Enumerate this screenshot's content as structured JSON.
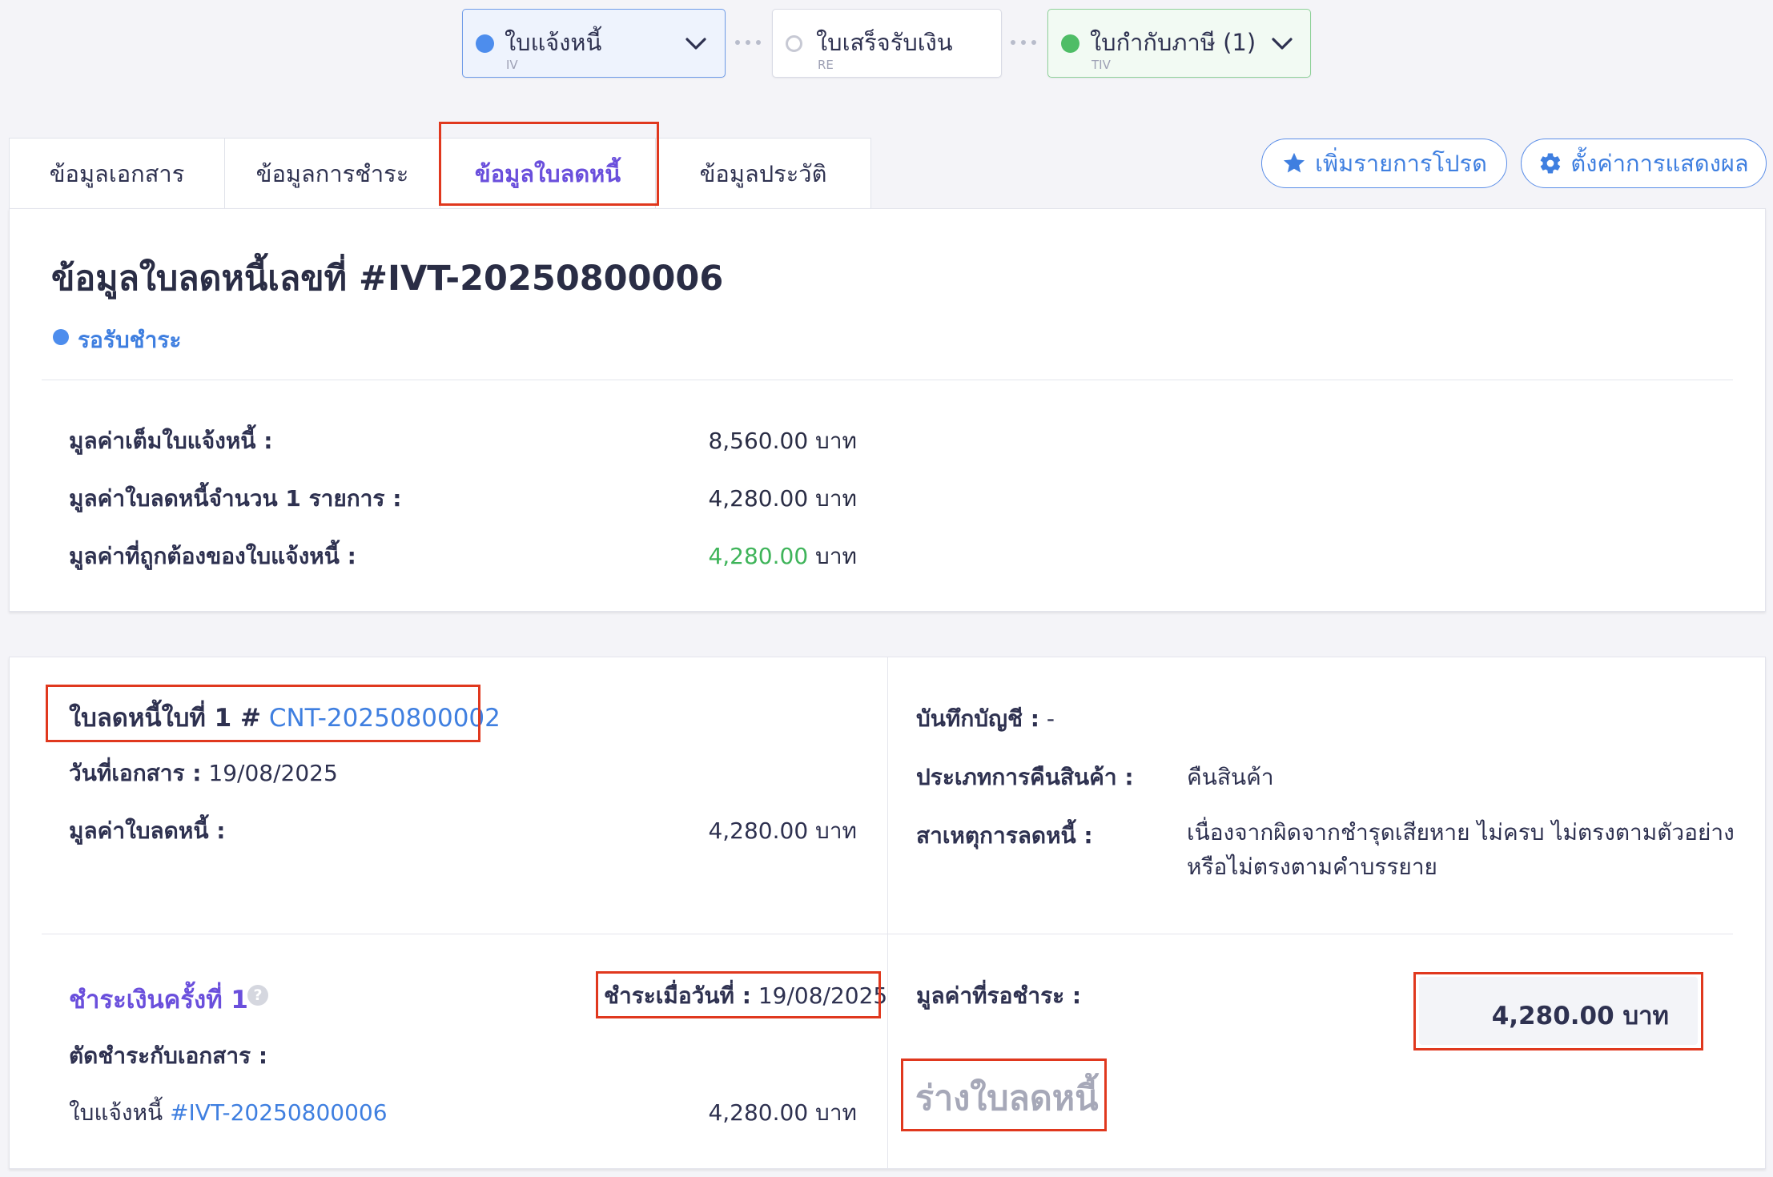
{
  "flow": {
    "steps": [
      {
        "label": "ใบแจ้งหนี้",
        "code": "IV"
      },
      {
        "label": "ใบเสร็จรับเงิน",
        "code": "RE"
      },
      {
        "label": "ใบกำกับภาษี (1)",
        "code": "TIV"
      }
    ]
  },
  "tabs": [
    "ข้อมูลเอกสาร",
    "ข้อมูลการชำระ",
    "ข้อมูลใบลดหนี้",
    "ข้อมูลประวัติ"
  ],
  "actions": {
    "favorite": "เพิ่มรายการโปรด",
    "display_settings": "ตั้งค่าการแสดงผล"
  },
  "summary": {
    "title": "ข้อมูลใบลดหนี้เลขที่ #IVT-20250800006",
    "status": "รอรับชำระ",
    "rows": [
      {
        "label": "มูลค่าเต็มใบแจ้งหนี้ :",
        "value": "8,560.00",
        "unit": "บาท"
      },
      {
        "label": "มูลค่าใบลดหนี้จำนวน 1 รายการ :",
        "value": "4,280.00",
        "unit": "บาท"
      },
      {
        "label": "มูลค่าที่ถูกต้องของใบแจ้งหนี้ :",
        "value": "4,280.00",
        "unit": "บาท"
      }
    ]
  },
  "credit_note": {
    "heading_prefix": "ใบลดหนี้ใบที่ 1 #",
    "number": "CNT-20250800002",
    "doc_date_label": "วันที่เอกสาร :",
    "doc_date": "19/08/2025",
    "value_label": "มูลค่าใบลดหนี้ :",
    "value": "4,280.00 บาท",
    "account_label": "บันทึกบัญชี :",
    "account_value": "-",
    "return_type_label": "ประเภทการคืนสินค้า :",
    "return_type": "คืนสินค้า",
    "reason_label": "สาเหตุการลดหนี้ :",
    "reason_line1": "เนื่องจากผิดจากชำรุดเสียหาย ไม่ครบ ไม่ตรงตามตัวอย่าง",
    "reason_line2": "หรือไม่ตรงตามคำบรรยาย"
  },
  "payment": {
    "title": "ชำระเงินครั้งที่ 1",
    "paid_on_label": "ชำระเมื่อวันที่ :",
    "paid_on": "19/08/2025",
    "offset_label": "ตัดชำระกับเอกสาร :",
    "doc_prefix": "ใบแจ้งหนี้",
    "doc_number": "#IVT-20250800006",
    "doc_amount": "4,280.00 บาท",
    "pending_label": "มูลค่าที่รอชำระ :",
    "pending_value": "4,280.00 บาท",
    "draft_label": "ร่างใบลดหนี้"
  },
  "colors": {
    "accent_purple": "#6a4fdc",
    "link_blue": "#3f7fe0",
    "success_green": "#3fb45a",
    "highlight_red": "#e0381e"
  }
}
